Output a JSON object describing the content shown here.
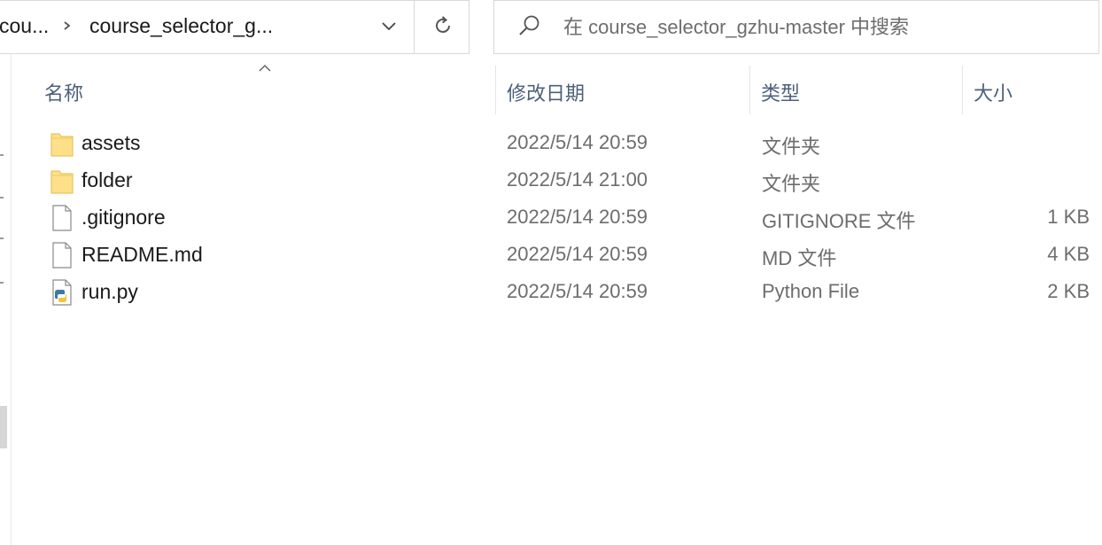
{
  "address_bar": {
    "crumbs": [
      "cou...",
      "course_selector_g..."
    ],
    "separator_icon": "chevron-right-icon",
    "dropdown_icon": "chevron-down-icon",
    "refresh_icon": "refresh-icon"
  },
  "search": {
    "placeholder": "在 course_selector_gzhu-master 中搜索",
    "icon": "search-icon"
  },
  "columns": {
    "name": "名称",
    "date": "修改日期",
    "type": "类型",
    "size": "大小",
    "sorted_by": "name",
    "sort_direction": "ascending"
  },
  "files": [
    {
      "name": "assets",
      "date": "2022/5/14 20:59",
      "type": "文件夹",
      "size": "",
      "icon": "folder-icon"
    },
    {
      "name": "folder",
      "date": "2022/5/14 21:00",
      "type": "文件夹",
      "size": "",
      "icon": "folder-icon"
    },
    {
      "name": ".gitignore",
      "date": "2022/5/14 20:59",
      "type": "GITIGNORE 文件",
      "size": "1 KB",
      "icon": "file-icon"
    },
    {
      "name": "README.md",
      "date": "2022/5/14 20:59",
      "type": "MD 文件",
      "size": "4 KB",
      "icon": "file-icon"
    },
    {
      "name": "run.py",
      "date": "2022/5/14 20:59",
      "type": "Python File",
      "size": "2 KB",
      "icon": "python-file-icon"
    }
  ],
  "colors": {
    "header_text": "#4c607a",
    "secondary_text": "#6d6d6d",
    "folder_fill": "#ffe08a",
    "border": "#d9d9d9"
  }
}
